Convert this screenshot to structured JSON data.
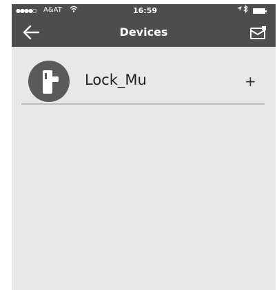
{
  "status_bar": {
    "signal": "●●●●○",
    "carrier": "A&AT",
    "time": "16:59"
  },
  "header": {
    "title": "Devices"
  },
  "devices": [
    {
      "name": "Lock_Mu",
      "action": "+"
    }
  ],
  "icons": {
    "back": "back-arrow-icon",
    "mail": "envelope-icon",
    "device": "door-lock-icon",
    "wifi": "wifi-icon",
    "location": "location-arrow-icon",
    "bluetooth": "bluetooth-icon",
    "battery": "battery-icon"
  },
  "colors": {
    "nav_bar": "#4d4d4d",
    "background": "#e8e8e8",
    "avatar": "#5a5a5a",
    "divider": "#bdbdbd"
  }
}
